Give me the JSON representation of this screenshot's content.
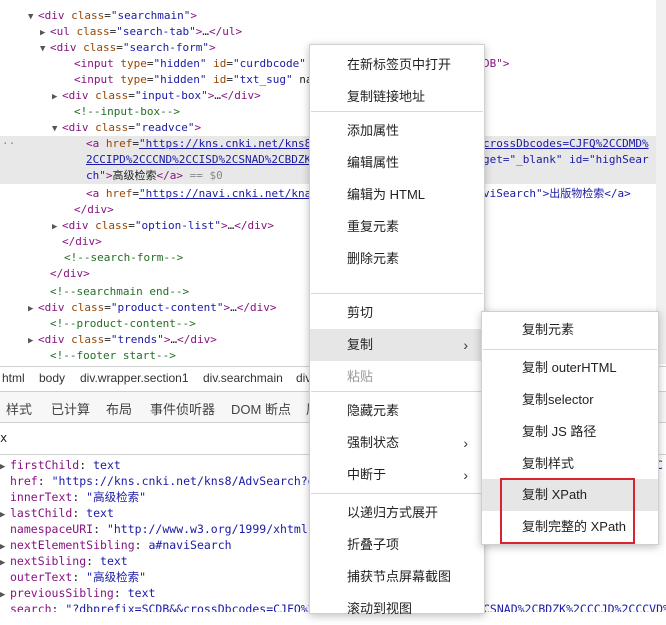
{
  "dom": {
    "lines": [
      {
        "indent": 40,
        "tri": "▼",
        "html": "<span class='tag'>&lt;div</span> <span class='attr'>class</span>=<span class='val'>\"searchmain\"</span><span class='tag'>&gt;</span>"
      },
      {
        "indent": 52,
        "tri": "▶",
        "html": "<span class='tag'>&lt;ul</span> <span class='attr'>class</span>=<span class='val'>\"search-tab\"</span><span class='tag'>&gt;</span>…<span class='tag'>&lt;/ul&gt;</span>"
      },
      {
        "indent": 52,
        "tri": "▼",
        "html": "<span class='tag'>&lt;div</span> <span class='attr'>class</span>=<span class='val'>\"search-form\"</span><span class='tag'>&gt;</span>"
      },
      {
        "indent": 74,
        "tri": "",
        "html": "<span class='tag'>&lt;input</span> <span class='attr'>type</span>=<span class='val'>\"hidden\"</span> <span class='attr'>id</span>=<span class='val'>\"curdbcode\"</span>"
      },
      {
        "indent": 74,
        "tri": "",
        "html": "<span class='tag'>&lt;input</span> <span class='attr'>type</span>=<span class='val'>\"hidden\"</span> <span class='attr'>id</span>=<span class='val'>\"txt_sug\"</span> na"
      },
      {
        "indent": 64,
        "tri": "▶",
        "html": "<span class='tag'>&lt;div</span> <span class='attr'>class</span>=<span class='val'>\"input-box\"</span><span class='tag'>&gt;</span>…<span class='tag'>&lt;/div&gt;</span>"
      },
      {
        "indent": 74,
        "tri": "",
        "html": "<span class='cmt'>&lt;!--input-box--&gt;</span>"
      },
      {
        "indent": 64,
        "tri": "▼",
        "html": "<span class='tag'>&lt;div</span> <span class='attr'>class</span>=<span class='val'>\"readvce\"</span><span class='tag'>&gt;</span>"
      },
      {
        "indent": 86,
        "tri": "",
        "hl": true,
        "html": "<span class='tag'>&lt;a</span> <span class='attr'>href</span>=<span class='link'>\"https://kns.cnki.net/kns8</span>"
      },
      {
        "indent": 86,
        "tri": "",
        "hl": true,
        "html": "<span class='link'>2CCIPD%2CCCND%2CCISD%2CSNAD%2CBDZK</span>"
      },
      {
        "indent": 86,
        "tri": "",
        "hl": true,
        "html": "<span class='val'>ch\"</span><span class='tag'>&gt;</span><span class='txt'>高级检索</span><span class='tag'>&lt;/a&gt;</span> <span class='gray'>== $0</span>"
      },
      {
        "indent": 86,
        "tri": "",
        "html": "<span class='tag'>&lt;a</span> <span class='attr'>href</span>=<span class='link'>\"https://navi.cnki.net/kna</span>"
      },
      {
        "indent": 74,
        "tri": "",
        "html": "<span class='tag'>&lt;/div&gt;</span>"
      },
      {
        "indent": 64,
        "tri": "▶",
        "html": "<span class='tag'>&lt;div</span> <span class='attr'>class</span>=<span class='val'>\"option-list\"</span><span class='tag'>&gt;</span>…<span class='tag'>&lt;/div&gt;</span>"
      },
      {
        "indent": 62,
        "tri": "",
        "html": "<span class='tag'>&lt;/div&gt;</span>"
      },
      {
        "indent": 64,
        "tri": "",
        "html": "<span class='cmt'>&lt;!--search-form--&gt;</span>"
      },
      {
        "indent": 50,
        "tri": "",
        "html": "<span class='tag'>&lt;/div&gt;</span>"
      },
      {
        "indent": 50,
        "tri": "",
        "html": "<span class='cmt'>&lt;!--searchmain end--&gt;</span>"
      },
      {
        "indent": 40,
        "tri": "▶",
        "html": "<span class='tag'>&lt;div</span> <span class='attr'>class</span>=<span class='val'>\"product-content\"</span><span class='tag'>&gt;</span>…<span class='tag'>&lt;/div&gt;</span>"
      },
      {
        "indent": 50,
        "tri": "",
        "html": "<span class='cmt'>&lt;!--product-content--&gt;</span>"
      },
      {
        "indent": 40,
        "tri": "▶",
        "html": "<span class='tag'>&lt;div</span> <span class='attr'>class</span>=<span class='val'>\"trends\"</span><span class='tag'>&gt;</span>…<span class='tag'>&lt;/div&gt;</span>"
      },
      {
        "indent": 50,
        "tri": "",
        "html": "<span class='cmt'>&lt;!--footer start--&gt;</span>"
      }
    ],
    "right_fragments": [
      {
        "text": "DB\">",
        "cls": "tag"
      },
      {
        "text": "crossDbcodes=CJFQ%2CCDMD%",
        "cls": "link"
      },
      {
        "text": "get=\"_blank\" id=\"highSear",
        "cls": "val"
      },
      {
        "text": "viSearch\">出版物检索</a>",
        "cls": "val"
      }
    ]
  },
  "breadcrumbs": [
    "html",
    "body",
    "div.wrapper.section1",
    "div.searchmain",
    "div"
  ],
  "bottom_tabs": [
    "样式",
    "已计算",
    "布局",
    "事件侦听器",
    "DOM 断点",
    "属"
  ],
  "filter": {
    "value": "x"
  },
  "properties": [
    {
      "tri": "▶",
      "key": "firstChild",
      "sep": ": ",
      "val": "text"
    },
    {
      "tri": "",
      "key": "href",
      "sep": ": ",
      "val": "\"https://kns.cnki.net/kns8/AdvSearch?dbp"
    },
    {
      "tri": "",
      "key": "innerText",
      "sep": ": ",
      "val": "\"高级检索\""
    },
    {
      "tri": "▶",
      "key": "lastChild",
      "sep": ": ",
      "val": "text"
    },
    {
      "tri": "",
      "key": "namespaceURI",
      "sep": ": ",
      "val": "\"http://www.w3.org/1999/xhtml\""
    },
    {
      "tri": "▶",
      "key": "nextElementSibling",
      "sep": ": ",
      "val": "a#naviSearch"
    },
    {
      "tri": "▶",
      "key": "nextSibling",
      "sep": ": ",
      "val": "text"
    },
    {
      "tri": "",
      "key": "outerText",
      "sep": ": ",
      "val": "\"高级检索\""
    },
    {
      "tri": "▶",
      "key": "previousSibling",
      "sep": ": ",
      "val": "text"
    },
    {
      "tri": "",
      "key": "search",
      "sep": ": ",
      "val": "\"?dbprefix=SCDB&&crossDbcodes=CJFQ%2C"
    }
  ],
  "props_right": [
    "C",
    "CSNAD%2CBDZK%2CCCJD%2CCCVD%"
  ],
  "context_menu": {
    "groups": [
      [
        "在新标签页中打开",
        "复制链接地址"
      ],
      [
        "添加属性",
        "编辑属性",
        "编辑为 HTML",
        "重复元素",
        "删除元素"
      ],
      [
        "剪切",
        "复制",
        "粘贴"
      ],
      [
        "隐藏元素",
        "强制状态",
        "中断于"
      ],
      [
        "以递归方式展开",
        "折叠子项",
        "捕获节点屏幕截图",
        "滚动到视图"
      ]
    ],
    "submenu_items": [
      "强制状态",
      "中断于",
      "复制"
    ],
    "disabled_items": [
      "粘贴"
    ],
    "selected_item": "复制"
  },
  "submenu": {
    "items": [
      "复制元素",
      "复制 outerHTML",
      "复制selector",
      "复制 JS 路径",
      "复制样式",
      "复制 XPath",
      "复制完整的 XPath"
    ],
    "highlighted": [
      "复制 XPath",
      "复制完整的 XPath"
    ],
    "selected_item": "复制 XPath"
  },
  "colors": {
    "highlight_box": "#d9232e",
    "selected_row": "#e6e6e6"
  }
}
